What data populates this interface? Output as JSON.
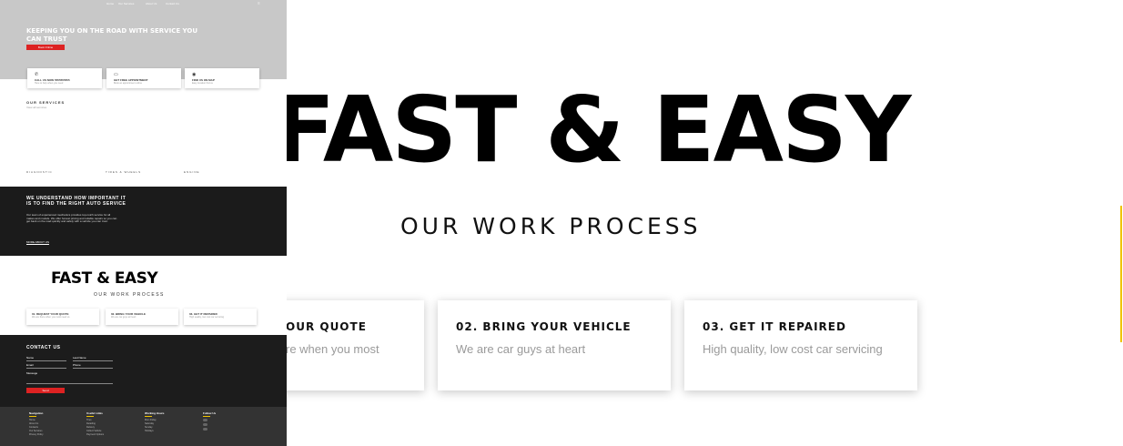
{
  "large": {
    "title": "FAST & EASY",
    "subtitle": "OUR WORK PROCESS",
    "steps": [
      {
        "title": "OUR QUOTE",
        "desc": "re when you most"
      },
      {
        "title": "02. BRING YOUR VEHICLE",
        "desc": "We are car guys at heart"
      },
      {
        "title": "03. GET IT REPAIRED",
        "desc": "High quality, low cost car servicing"
      }
    ],
    "accent_color": "#f0c400"
  },
  "mini": {
    "nav": [
      "Home",
      "Our Services",
      "About Us",
      "Contact Us"
    ],
    "hero": {
      "headline": "KEEPING YOU ON THE ROAD WITH SERVICE YOU CAN TRUST",
      "button": "Book Online"
    },
    "feature_cards": [
      {
        "icon": "phone-icon",
        "title": "CALL US NOW 5555555555",
        "desc": "Here to help when you need"
      },
      {
        "icon": "calendar-icon",
        "title": "GET FREE APPOINTMENT",
        "desc": "Book an appointment online"
      },
      {
        "icon": "map-pin-icon",
        "title": "FIND US ON MAP",
        "desc": "Easy location find us"
      }
    ],
    "services": {
      "heading": "OUR SERVICES",
      "subheading": "View all services",
      "items": [
        "DIAGNOSTIC",
        "TIRES & WHEELS",
        "ENGINE"
      ]
    },
    "about": {
      "headline": "WE UNDERSTAND HOW IMPORTANT IT IS TO FIND THE RIGHT AUTO SERVICE",
      "body": "Our team of experienced mechanics provides top-notch service for all makes and models. We offer honest pricing and reliable repairs so you can get back on the road quickly and safely with a vehicle you can trust.",
      "link": "MORE ABOUT US"
    },
    "process": {
      "title": "FAST & EASY",
      "subtitle": "OUR WORK PROCESS",
      "steps": [
        {
          "title": "01. REQUEST YOUR QUOTE",
          "desc": "We are there when you most need us"
        },
        {
          "title": "02. BRING YOUR VEHICLE",
          "desc": "We are car guys at heart"
        },
        {
          "title": "03. GET IT REPAIRED",
          "desc": "High quality, low cost car servicing"
        }
      ]
    },
    "contact": {
      "heading": "CONTACT US",
      "fields": [
        "Name",
        "Last Name",
        "Email",
        "Phone",
        "Message"
      ],
      "button": "Send"
    },
    "footer": {
      "columns": [
        {
          "heading": "Navigation",
          "items": [
            "Home",
            "About Us",
            "Contacts",
            "Our Services",
            "Privacy Policy"
          ]
        },
        {
          "heading": "Useful Links",
          "items": [
            "Tires",
            "Detailing",
            "Delivery",
            "Collect Vehicle",
            "Payment Options"
          ]
        },
        {
          "heading": "Working Hours",
          "items": [
            "Mon-Friday",
            "Saturday",
            "Sunday",
            "Holidays"
          ]
        },
        {
          "heading": "Follow Us",
          "items": []
        }
      ],
      "social_icons": [
        "facebook-icon",
        "twitter-icon",
        "instagram-icon"
      ]
    },
    "brand_red": "#dd2222",
    "dark_bg": "#1b1b1b"
  }
}
